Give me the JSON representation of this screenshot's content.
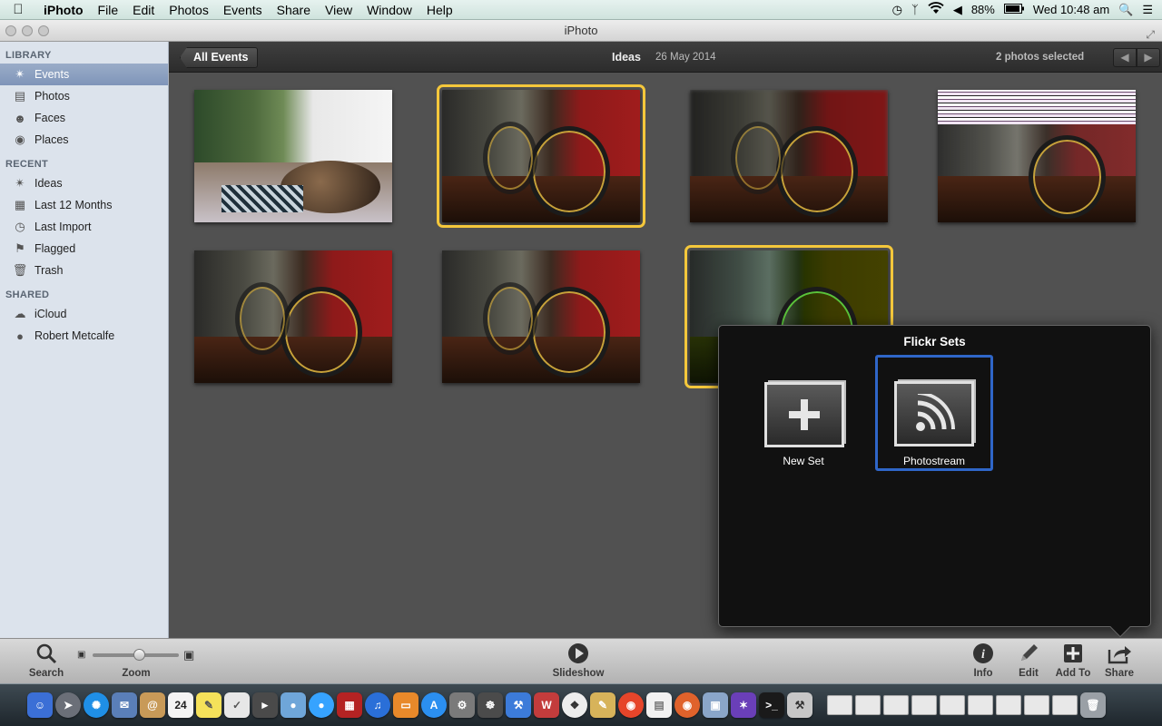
{
  "menubar": {
    "app_name": "iPhoto",
    "items": [
      "File",
      "Edit",
      "Photos",
      "Events",
      "Share",
      "View",
      "Window",
      "Help"
    ],
    "battery": "88%",
    "clock": "Wed 10:48 am"
  },
  "window": {
    "title": "iPhoto"
  },
  "sidebar": {
    "library_header": "LIBRARY",
    "library": [
      {
        "label": "Events",
        "icon": "events-icon"
      },
      {
        "label": "Photos",
        "icon": "photos-icon"
      },
      {
        "label": "Faces",
        "icon": "faces-icon"
      },
      {
        "label": "Places",
        "icon": "places-icon"
      }
    ],
    "recent_header": "RECENT",
    "recent": [
      {
        "label": "Ideas",
        "icon": "event-palm-icon"
      },
      {
        "label": "Last 12 Months",
        "icon": "calendar-icon"
      },
      {
        "label": "Last Import",
        "icon": "clock-icon"
      },
      {
        "label": "Flagged",
        "icon": "flag-icon"
      },
      {
        "label": "Trash",
        "icon": "trash-icon"
      }
    ],
    "shared_header": "SHARED",
    "shared": [
      {
        "label": "iCloud",
        "icon": "icloud-icon"
      },
      {
        "label": "Robert Metcalfe",
        "icon": "shared-library-icon"
      }
    ],
    "selected_item": "Events"
  },
  "event_bar": {
    "back_label": "All Events",
    "event_name": "Ideas",
    "event_date": "26 May 2014",
    "selection_status": "2 photos selected"
  },
  "photos": {
    "count": 7,
    "selected_indices": [
      1,
      6
    ]
  },
  "flickr_popover": {
    "title": "Flickr Sets",
    "new_set_label": "New Set",
    "photostream_label": "Photostream",
    "active_tile": "Photostream"
  },
  "toolbar": {
    "search_label": "Search",
    "zoom_label": "Zoom",
    "zoom_level": 0.55,
    "slideshow_label": "Slideshow",
    "info_label": "Info",
    "edit_label": "Edit",
    "add_to_label": "Add To",
    "share_label": "Share"
  },
  "dock": {
    "calendar_day": "24"
  },
  "colors": {
    "selection_outline": "#f4c73b",
    "active_tile_border": "#2f66c8",
    "sidebar_bg": "#dce3ec",
    "main_bg": "#515151"
  }
}
